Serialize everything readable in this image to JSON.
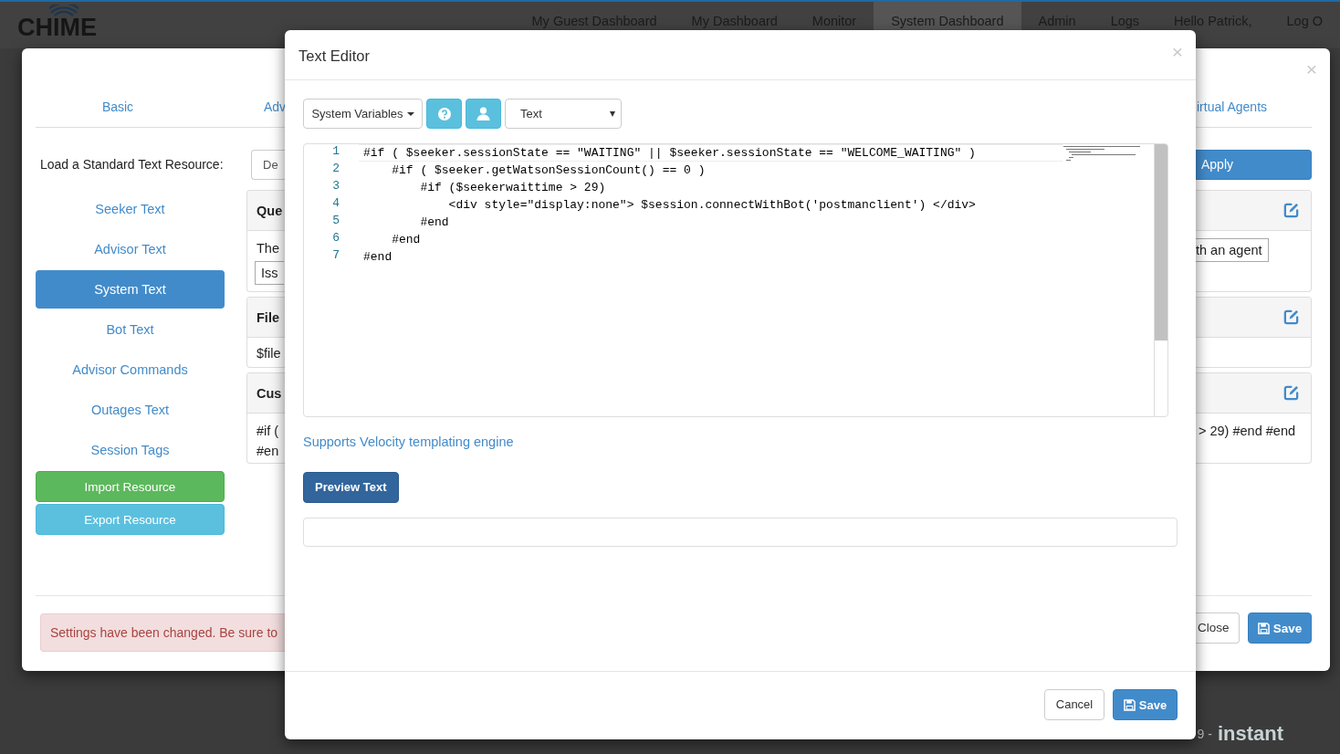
{
  "nav": {
    "logo": "CHIME",
    "links": [
      {
        "label": "My Guest Dashboard",
        "selected": false
      },
      {
        "label": "My Dashboard",
        "selected": false
      },
      {
        "label": "Monitor",
        "selected": false
      },
      {
        "label": "System Dashboard",
        "selected": true
      },
      {
        "label": "Admin",
        "selected": false
      },
      {
        "label": "Logs",
        "selected": false
      },
      {
        "label": "Hello Patrick,",
        "selected": false
      },
      {
        "label": "Log O",
        "selected": false
      }
    ]
  },
  "footer": {
    "version_text": "9 -",
    "brand": "instant"
  },
  "settings_dialog": {
    "close_icon": "×",
    "tabs": [
      {
        "label": "Basic",
        "selected": false
      },
      {
        "label": "Adv",
        "selected": false
      },
      {
        "label": "irtual Agents",
        "selected": false
      }
    ],
    "resource_label": "Load a Standard Text Resource:",
    "resource_select": "De",
    "apply_button": "Apply",
    "sidebar": {
      "items": [
        {
          "label": "Seeker Text",
          "selected": false
        },
        {
          "label": "Advisor Text",
          "selected": false
        },
        {
          "label": "System Text",
          "selected": true
        },
        {
          "label": "Bot Text",
          "selected": false
        },
        {
          "label": "Advisor Commands",
          "selected": false
        },
        {
          "label": "Outages Text",
          "selected": false
        },
        {
          "label": "Session Tags",
          "selected": false
        }
      ]
    },
    "import_button": "Import Resource",
    "export_button": "Export Resource",
    "panels": [
      {
        "header": "Que",
        "left_body": [
          {
            "kind": "text",
            "text": "The"
          },
          {
            "kind": "input",
            "value": "Iss"
          }
        ],
        "right_body": [
          {
            "kind": "input",
            "value": "th an agent"
          }
        ]
      },
      {
        "header": "File",
        "left_body": [
          {
            "kind": "text",
            "text": "$file"
          }
        ]
      },
      {
        "header": "Cus",
        "left_body": [
          {
            "kind": "text",
            "text": "#if ("
          },
          {
            "kind": "text",
            "text": "#en"
          }
        ],
        "right_body": [
          {
            "kind": "text",
            "text": "> 29) #end #end"
          }
        ]
      }
    ],
    "alert": "Settings have been changed. Be sure to",
    "close_button": "Close",
    "save_button": "Save"
  },
  "text_editor": {
    "title": "Text Editor",
    "close_icon": "×",
    "variables_button": "System Variables",
    "format_select": "Text",
    "code_lines": [
      {
        "number": "1",
        "code": "#if ( $seeker.sessionState == \"WAITING\" || $seeker.sessionState == \"WELCOME_WAITING\" )",
        "current": true
      },
      {
        "number": "2",
        "code": "    #if ( $seeker.getWatsonSessionCount() == 0 )",
        "current": false
      },
      {
        "number": "3",
        "code": "        #if ($seekerwaittime > 29)",
        "current": false
      },
      {
        "number": "4",
        "code": "            <div style=\"display:none\"> $session.connectWithBot('postmanclient') </div>",
        "current": false
      },
      {
        "number": "5",
        "code": "        #end",
        "current": false
      },
      {
        "number": "6",
        "code": "    #end",
        "current": false
      },
      {
        "number": "7",
        "code": "#end",
        "current": false
      }
    ],
    "help_link": "Supports Velocity templating engine",
    "preview_button": "Preview Text",
    "cancel_button": "Cancel",
    "save_button": "Save"
  }
}
